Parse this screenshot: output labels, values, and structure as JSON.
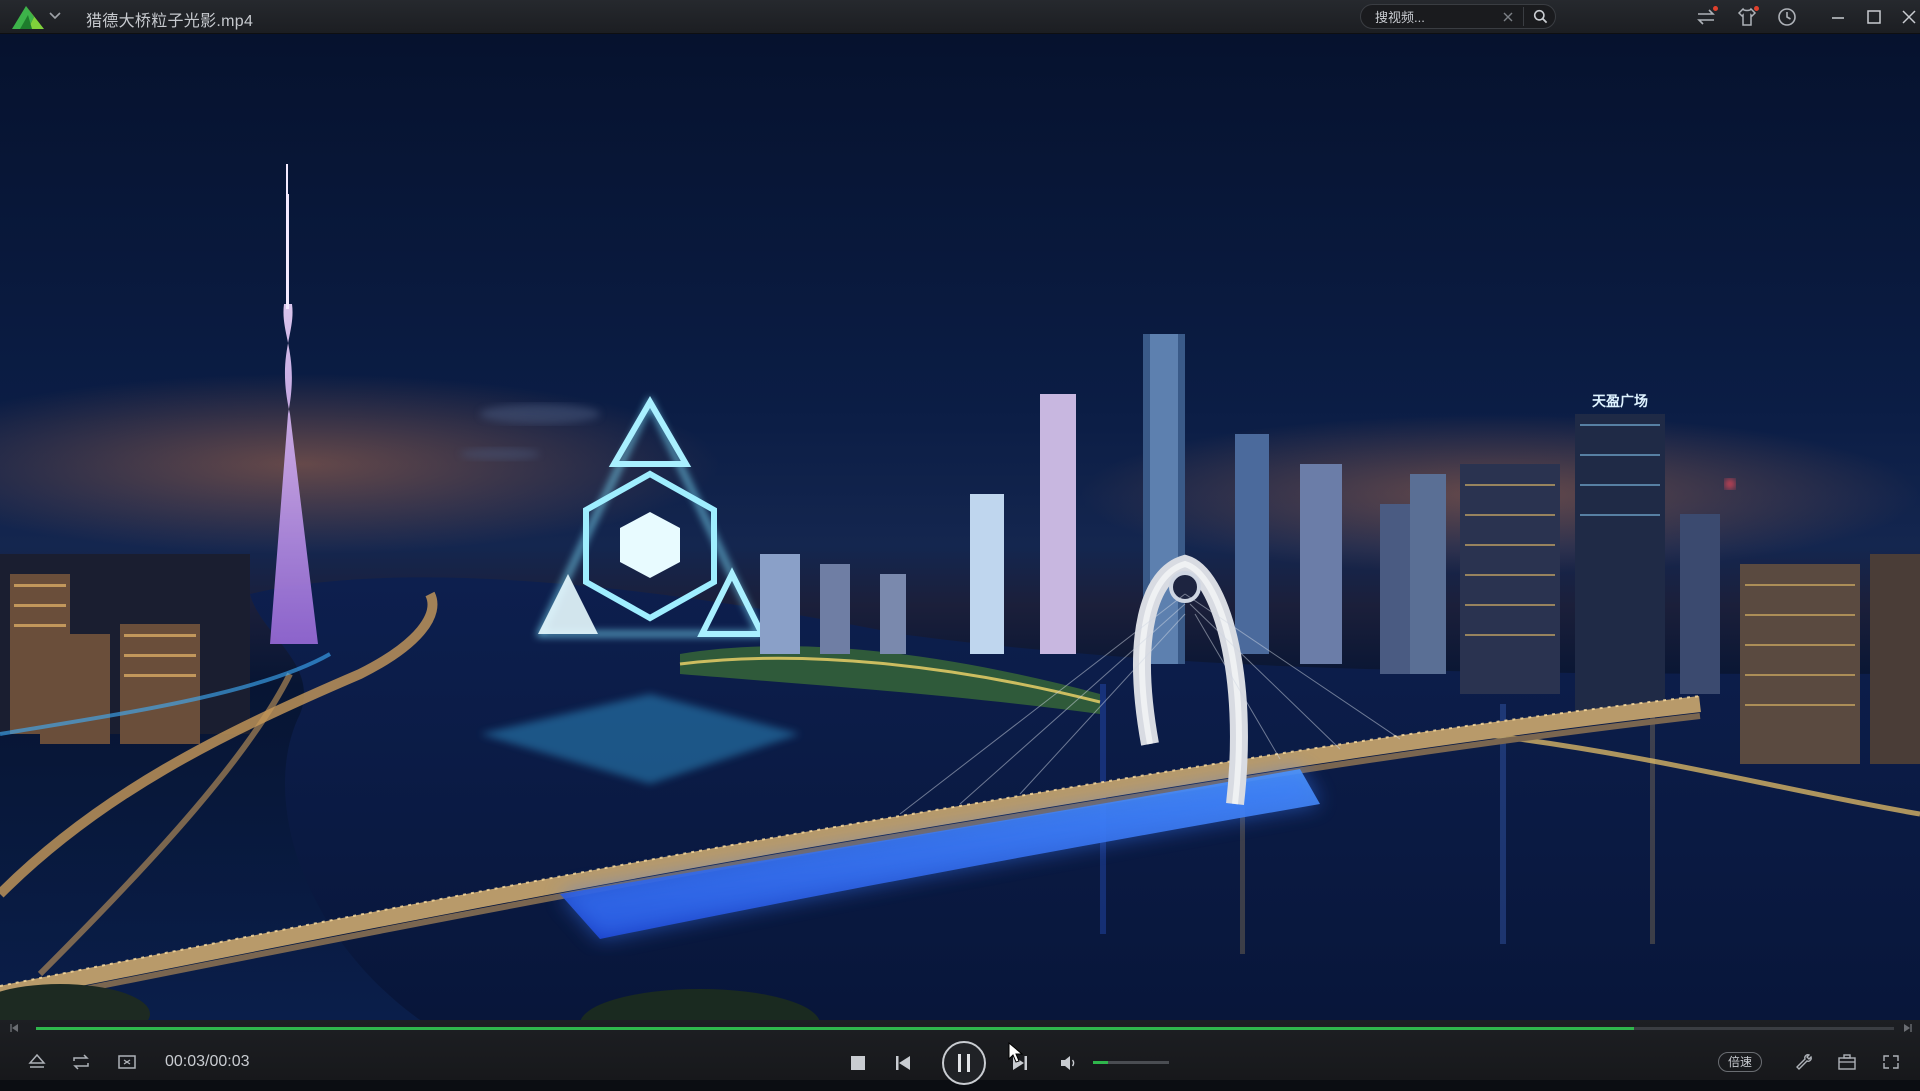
{
  "window": {
    "title": "猎德大桥粒子光影.mp4"
  },
  "search": {
    "placeholder": "搜视频..."
  },
  "video": {
    "sign_text": "天盈广场"
  },
  "playback": {
    "time": "00:03/00:03",
    "progress": 0.86,
    "volume": 0.2,
    "speed_label": "倍速",
    "state": "playing"
  },
  "colors": {
    "accent": "#2fb64c",
    "titlebar_bg": "#1f2125",
    "control_bg": "#1b1d20",
    "notification": "#e0402c"
  },
  "icons": {
    "titlebar": [
      "app-logo-icon",
      "chevron-down-icon",
      "clear-icon",
      "search-icon",
      "swap-icon",
      "shirt-icon",
      "history-icon",
      "minimize-icon",
      "maximize-icon",
      "close-icon"
    ],
    "controls": [
      "eject-icon",
      "repeat-icon",
      "screenshot-icon",
      "stop-icon",
      "previous-icon",
      "pause-icon",
      "next-icon",
      "volume-icon",
      "tools-icon",
      "toolbox-icon",
      "fullscreen-icon"
    ]
  }
}
